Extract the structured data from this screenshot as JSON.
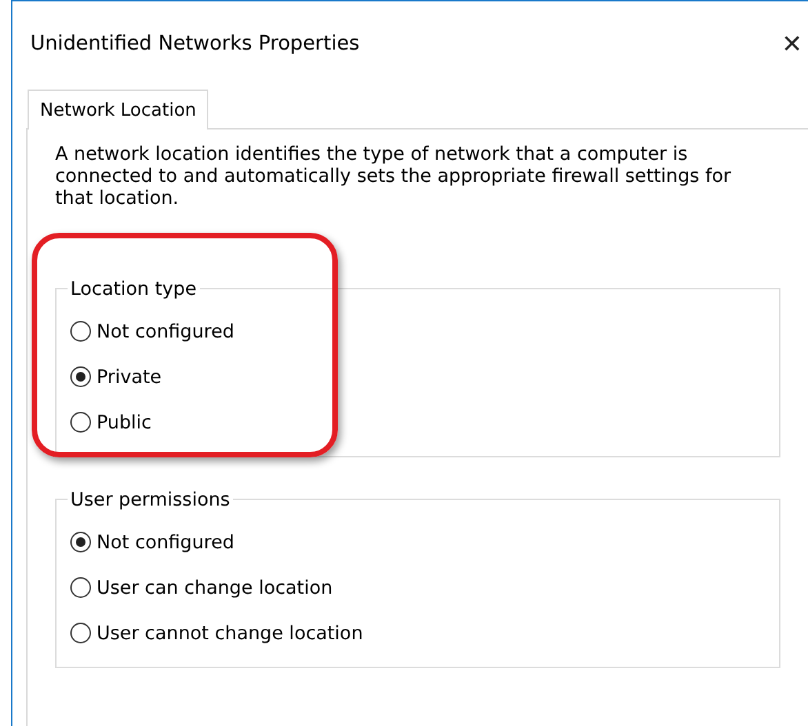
{
  "window": {
    "title": "Unidentified Networks Properties",
    "close": "✕"
  },
  "tabs": [
    {
      "label": "Network Location",
      "selected": true
    }
  ],
  "description": "A network location identifies the type of network that a computer is connected to and automatically sets the appropriate firewall settings for that location.",
  "groups": [
    {
      "title": "Location type",
      "highlighted": true,
      "options": [
        {
          "label": "Not configured",
          "selected": false
        },
        {
          "label": "Private",
          "selected": true
        },
        {
          "label": "Public",
          "selected": false
        }
      ]
    },
    {
      "title": "User permissions",
      "highlighted": false,
      "options": [
        {
          "label": "Not configured",
          "selected": true
        },
        {
          "label": "User can change location",
          "selected": false
        },
        {
          "label": "User cannot change location",
          "selected": false
        }
      ]
    }
  ]
}
